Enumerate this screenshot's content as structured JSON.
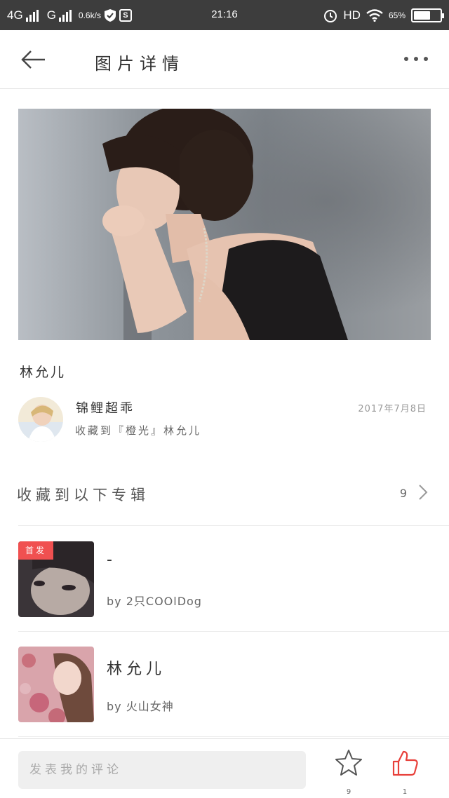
{
  "status_bar": {
    "network_left": "4G",
    "network_mid": "G",
    "speed": "0.6k/s",
    "app_badge": "S",
    "time": "21:16",
    "hd": "HD",
    "battery_text": "65%",
    "battery_level": 0.65
  },
  "header": {
    "back_icon": "arrow-left-icon",
    "title": "图片详情",
    "more_icon": "more-dots-icon"
  },
  "photo": {
    "title": "林允儿"
  },
  "uploader": {
    "name": "锦鲤超乖",
    "date": "2017年7月8日",
    "collected_to": "收藏到『橙光』林允儿"
  },
  "albums_section": {
    "heading": "收藏到以下专辑",
    "count": "9",
    "chevron_icon": "chevron-right-icon",
    "items": [
      {
        "badge": "首发",
        "title": "-",
        "author": "by 2只COOlDog"
      },
      {
        "badge": "",
        "title": "林允儿",
        "author": "by 火山女神"
      }
    ]
  },
  "bottom_bar": {
    "comment_placeholder": "发表我的评论",
    "favorite_icon": "star-icon",
    "favorite_count": "9",
    "like_icon": "thumbs-up-icon",
    "like_count": "1",
    "accent_color": "#e8403a"
  }
}
